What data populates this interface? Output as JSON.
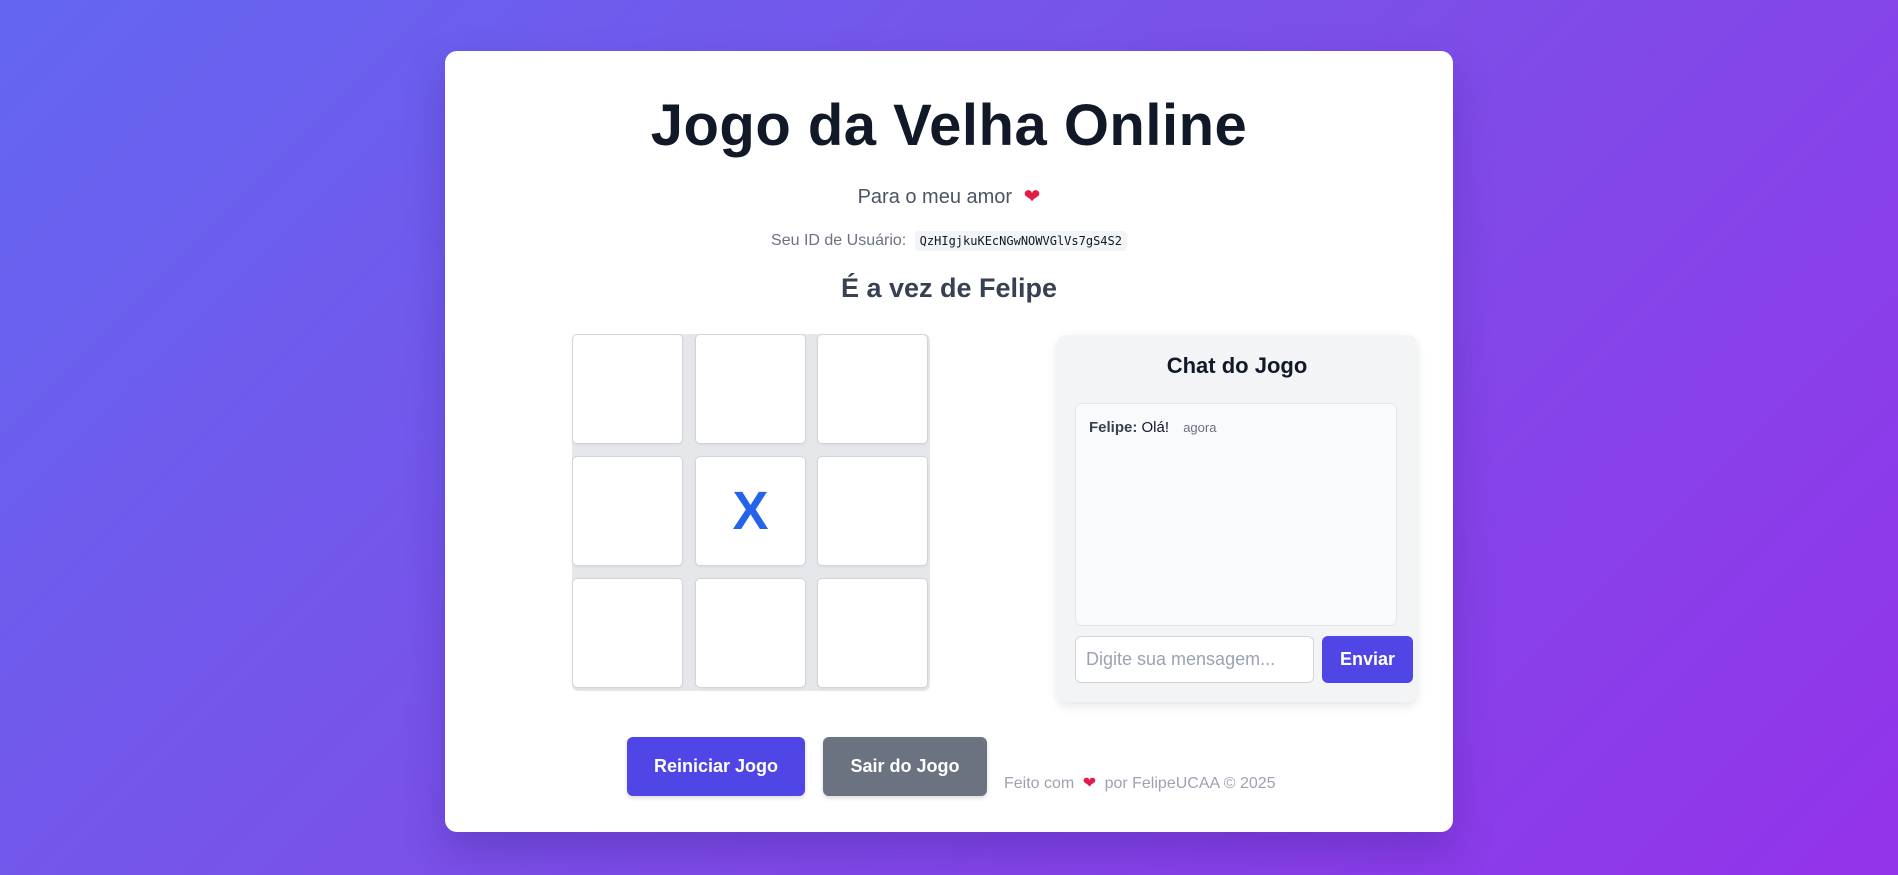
{
  "header": {
    "title": "Jogo da Velha Online",
    "subtitle": "Para o meu amor",
    "heart_glyph": "❤",
    "user_id_label": "Seu ID de Usuário:",
    "user_id": "QzHIgjkuKEcNGwNOWVGlVs7gS4S2"
  },
  "game": {
    "turn_text": "É a vez de Felipe",
    "board": [
      "",
      "",
      "",
      "",
      "X",
      "",
      "",
      "",
      ""
    ],
    "x_color": "#2563eb"
  },
  "chat": {
    "title": "Chat do Jogo",
    "messages": [
      {
        "author": "Felipe:",
        "text": "Olá!",
        "time": "agora"
      }
    ],
    "input_placeholder": "Digite sua mensagem...",
    "send_label": "Enviar"
  },
  "actions": {
    "restart_label": "Reiniciar Jogo",
    "exit_label": "Sair do Jogo"
  },
  "footer": {
    "prefix": "Feito com",
    "heart_glyph": "❤",
    "suffix": "por FelipeUCAA © 2025"
  },
  "colors": {
    "accent": "#4f46e5",
    "secondary": "#6b7280",
    "heart": "#e11d48"
  }
}
